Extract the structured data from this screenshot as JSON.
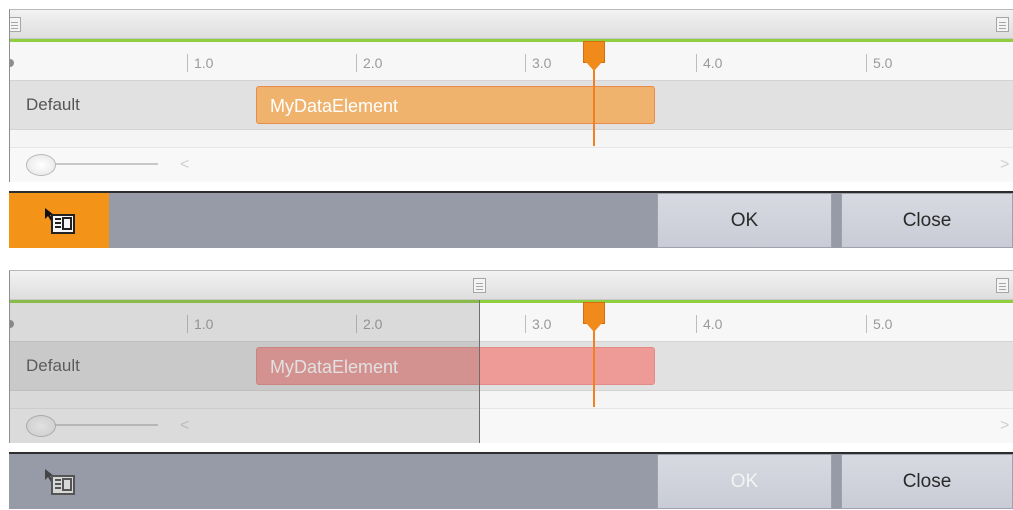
{
  "panels": [
    {
      "state": "valid",
      "track_label": "Default",
      "element_label": "MyDataElement",
      "ruler_ticks": [
        "1.0",
        "2.0",
        "3.0",
        "4.0",
        "5.0"
      ],
      "scroll_left": "<",
      "scroll_right": ">",
      "ok_label": "OK",
      "close_label": "Close",
      "ok_enabled": true,
      "icon": "data-list-icon",
      "colors": {
        "element_fill": "#f0b36e",
        "playhead": "#f08020",
        "icon_highlight": "#f39419"
      }
    },
    {
      "state": "invalid",
      "track_label": "Default",
      "element_label": "MyDataElement",
      "ruler_ticks": [
        "1.0",
        "2.0",
        "3.0",
        "4.0",
        "5.0"
      ],
      "scroll_left": "<",
      "scroll_right": ">",
      "ok_label": "OK",
      "close_label": "Close",
      "ok_enabled": false,
      "icon": "data-list-icon",
      "colors": {
        "element_fill": "#ee9a96",
        "playhead": "#f08020"
      }
    }
  ]
}
